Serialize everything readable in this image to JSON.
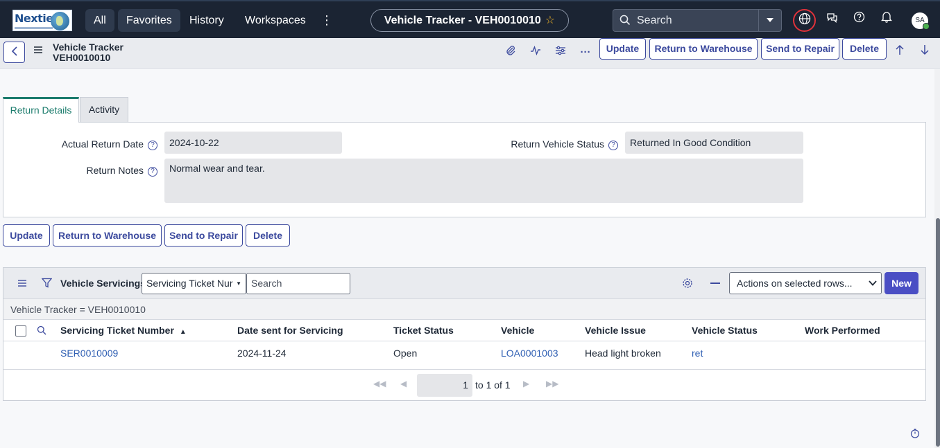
{
  "nav": {
    "logo_text": "Nexties",
    "all": "All",
    "favorites": "Favorites",
    "history": "History",
    "workspaces": "Workspaces",
    "more": "⋮",
    "record_pill": "Vehicle Tracker - VEH0010010",
    "search_placeholder": "Search",
    "avatar_initials": "SA"
  },
  "header": {
    "title_line1": "Vehicle Tracker",
    "title_line2": "VEH0010010",
    "buttons": {
      "update": "Update",
      "return_to_warehouse": "Return to Warehouse",
      "send_to_repair": "Send to Repair",
      "delete": "Delete"
    }
  },
  "tabs": [
    {
      "label": "Return Details",
      "active": true
    },
    {
      "label": "Activity",
      "active": false
    }
  ],
  "form": {
    "actual_return_date_label": "Actual Return Date",
    "actual_return_date_value": "2024-10-22",
    "return_vehicle_status_label": "Return Vehicle Status",
    "return_vehicle_status_value": "Returned In Good Condition",
    "return_notes_label": "Return Notes",
    "return_notes_value": "Normal wear and tear."
  },
  "bottom_buttons": {
    "update": "Update",
    "return_to_warehouse": "Return to Warehouse",
    "send_to_repair": "Send to Repair",
    "delete": "Delete"
  },
  "related_list": {
    "title": "Vehicle Servicings",
    "search_field": "Servicing Ticket Nur",
    "search_placeholder": "Search",
    "actions_select": "Actions on selected rows...",
    "new_button": "New",
    "filter_text": "Vehicle Tracker = VEH0010010",
    "columns": [
      "Servicing Ticket Number",
      "Date sent for Servicing",
      "Ticket Status",
      "Vehicle",
      "Vehicle Issue",
      "Vehicle Status",
      "Work Performed"
    ],
    "sort_indicator": "▲",
    "rows": [
      {
        "ticket": "SER0010009",
        "date_sent": "2024-11-24",
        "ticket_status": "Open",
        "vehicle": "LOA0001003",
        "issue": "Head light broken",
        "vehicle_status": "ret",
        "work_performed": ""
      }
    ],
    "pagination": {
      "page_value": "1",
      "range_text": "to 1 of 1"
    }
  },
  "colors": {
    "topbar": "#1b2433",
    "accent": "#3c4a9e",
    "tab_active": "#1c7c6d",
    "new_button": "#4a4ec4",
    "globe_ring": "#e0323a"
  }
}
